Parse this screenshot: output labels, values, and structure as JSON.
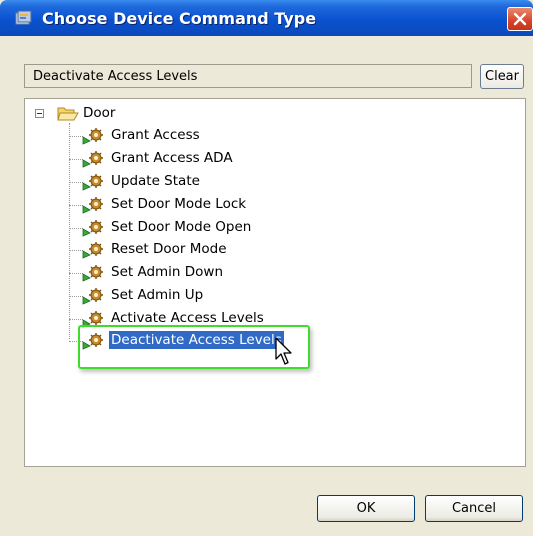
{
  "window": {
    "title": "Choose Device Command Type"
  },
  "command_field": {
    "value": "Deactivate Access Levels"
  },
  "clear_button": {
    "label": "Clear"
  },
  "tree": {
    "root_label": "Door",
    "root_expanded": true,
    "items": [
      {
        "label": "Grant Access",
        "selected": false
      },
      {
        "label": "Grant Access ADA",
        "selected": false
      },
      {
        "label": "Update State",
        "selected": false
      },
      {
        "label": "Set Door Mode Lock",
        "selected": false
      },
      {
        "label": "Set Door Mode Open",
        "selected": false
      },
      {
        "label": "Reset Door Mode",
        "selected": false
      },
      {
        "label": "Set Admin Down",
        "selected": false
      },
      {
        "label": "Set Admin Up",
        "selected": false
      },
      {
        "label": "Activate Access Levels",
        "selected": false
      },
      {
        "label": "Deactivate Access Levels",
        "selected": true
      }
    ]
  },
  "buttons": {
    "ok_label": "OK",
    "cancel_label": "Cancel"
  },
  "icons": {
    "title": "window-app-icon",
    "close": "close-icon",
    "folder": "open-folder-icon",
    "command": "gear-command-icon",
    "cursor": "mouse-pointer-icon"
  },
  "colors": {
    "titlebar": "#0a52d0",
    "selection": "#316ac5",
    "highlight_box": "#3fdc2e",
    "close_button": "#d5452c"
  }
}
